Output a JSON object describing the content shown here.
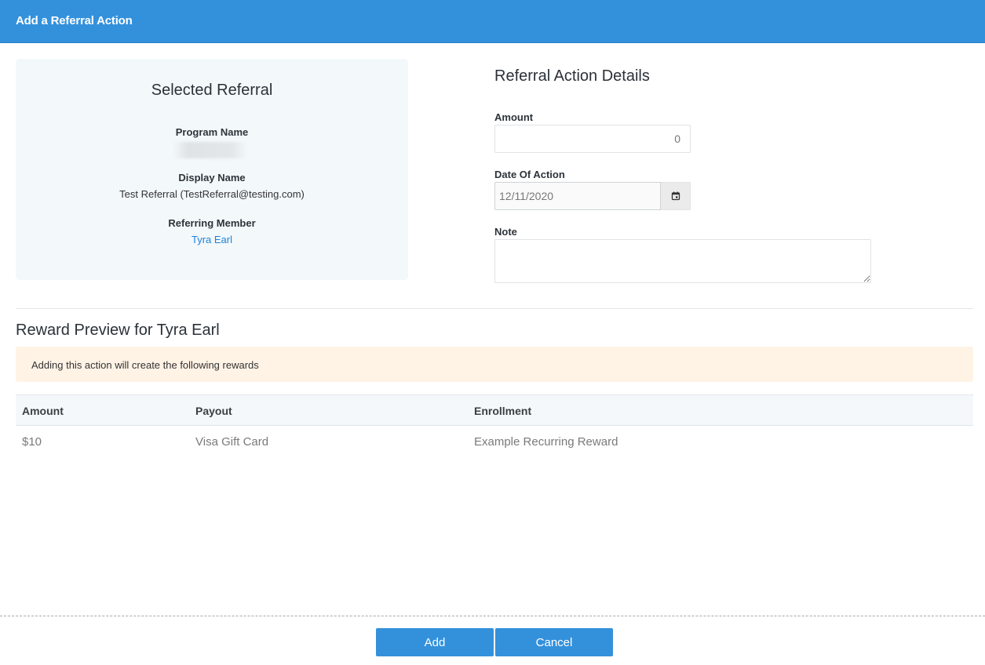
{
  "header": {
    "title": "Add a Referral Action"
  },
  "selected_referral": {
    "title": "Selected Referral",
    "program_name_label": "Program Name",
    "display_name_label": "Display Name",
    "display_name_value": "Test Referral (TestReferral@testing.com)",
    "referring_member_label": "Referring Member",
    "referring_member_value": "Tyra Earl"
  },
  "details": {
    "title": "Referral Action Details",
    "amount_label": "Amount",
    "amount_value": "0",
    "date_label": "Date Of Action",
    "date_value": "12/11/2020",
    "note_label": "Note",
    "note_value": "",
    "calendar_icon": "calendar-icon"
  },
  "preview": {
    "title": "Reward Preview for Tyra Earl",
    "notice": "Adding this action will create the following rewards",
    "columns": {
      "amount": "Amount",
      "payout": "Payout",
      "enrollment": "Enrollment"
    },
    "rows": [
      {
        "amount": "$10",
        "payout": "Visa Gift Card",
        "enrollment": "Example Recurring Reward"
      }
    ]
  },
  "footer": {
    "add_label": "Add",
    "cancel_label": "Cancel"
  },
  "colors": {
    "accent": "#3391dc",
    "link": "#1d83d8",
    "notice_bg": "#fff3e6",
    "card_bg": "#f3f8fb"
  }
}
